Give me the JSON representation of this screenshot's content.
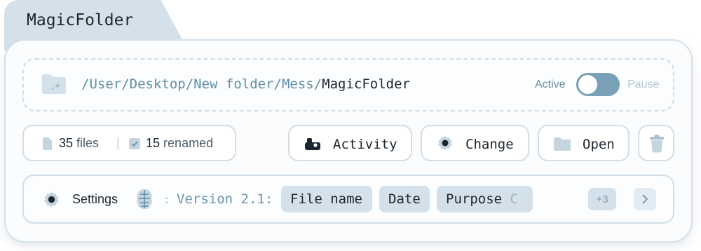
{
  "window": {
    "title": "MagicFolder"
  },
  "path": {
    "prefix": "/User/Desktop/New folder/Mess/",
    "folder_name": "MagicFolder",
    "status_active": "Active",
    "status_pause": "Pause",
    "toggle_state": "active"
  },
  "stats": {
    "files_count": "35",
    "files_label": "files",
    "separator": "|",
    "renamed_count": "15",
    "renamed_label": "renamed"
  },
  "actions": {
    "activity_label": "Activity",
    "change_label": "Change",
    "open_label": "Open",
    "delete_icon": "trash-icon"
  },
  "settings": {
    "label": "Settings",
    "colon": ":",
    "version_text": "Version 2.1:",
    "chips": [
      "File name",
      "Date",
      "Purpose"
    ],
    "chip_overflow_char": "C",
    "more_count": "+3"
  },
  "colors": {
    "accent": "#7aa0b8",
    "tab_bg": "#d5e1ea",
    "border": "#d2dde5",
    "path_prefix": "#5f8ea6"
  }
}
